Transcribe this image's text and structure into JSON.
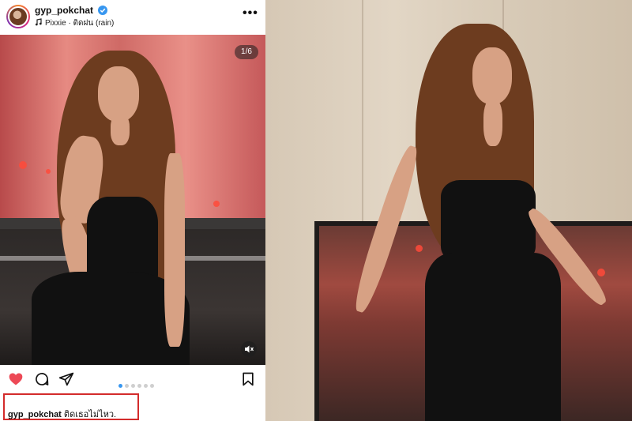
{
  "post": {
    "username": "gyp_pokchat",
    "audio": "Pixxie · ติดฝน (rain)",
    "more_label": "•••",
    "image_counter": "1/6",
    "carousel": {
      "count": 6,
      "active_index": 1
    },
    "caption_username": "gyp_pokchat",
    "caption_text": "ติดเธอไม่ไหว."
  },
  "icons": {
    "verified": "verified-badge-icon",
    "music": "music-note-icon",
    "more": "more-options-icon",
    "like": "heart-icon",
    "comment": "comment-icon",
    "share": "send-icon",
    "save": "bookmark-icon",
    "mute": "speaker-muted-icon"
  },
  "colors": {
    "like_active": "#ED4956",
    "verified": "#3897F0",
    "highlight_border": "#D32B2B"
  }
}
